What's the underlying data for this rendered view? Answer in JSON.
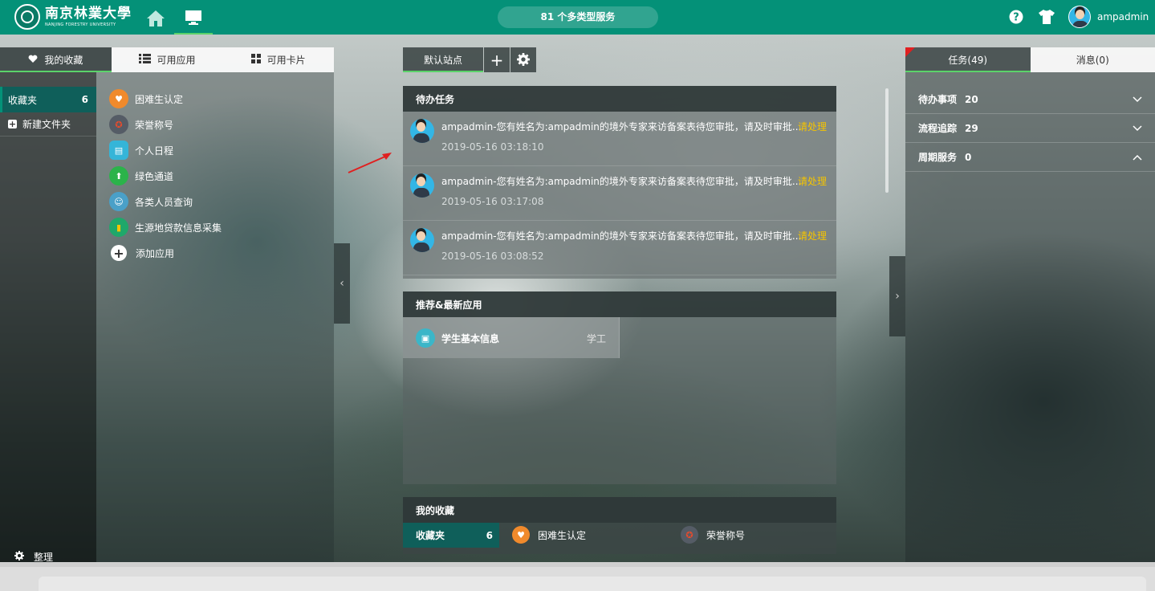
{
  "header": {
    "logo_cn": "南京林業大學",
    "logo_en": "NANJING FORESTRY UNIVERSITY",
    "services_pill": "81 个多类型服务",
    "username": "ampadmin"
  },
  "left": {
    "tabs": [
      {
        "label": "我的收藏",
        "icon": "heart-icon"
      },
      {
        "label": "可用应用",
        "icon": "list-icon"
      },
      {
        "label": "可用卡片",
        "icon": "grid-icon"
      }
    ],
    "folder": {
      "label": "收藏夹",
      "count": "6"
    },
    "new_folder": "新建文件夹",
    "arrange": "整理",
    "apps": [
      {
        "label": "困难生认定",
        "color": "#f08a2c"
      },
      {
        "label": "荣誉称号",
        "color": "#555c66"
      },
      {
        "label": "个人日程",
        "color": "#35b5d8"
      },
      {
        "label": "绿色通道",
        "color": "#2bb34a"
      },
      {
        "label": "各类人员查询",
        "color": "#4aa0c8"
      },
      {
        "label": "生源地贷款信息采集",
        "color": "#1fa86a"
      },
      {
        "label": "添加应用",
        "color": "#ffffff"
      }
    ]
  },
  "center": {
    "station_tab": "默认站点",
    "todo": {
      "title": "待办任务",
      "items": [
        {
          "text": "ampadmin-您有姓名为:ampadmin的境外专家来访备案表待您审批，请及时审批...",
          "action": "请处理",
          "time": "2019-05-16 03:18:10"
        },
        {
          "text": "ampadmin-您有姓名为:ampadmin的境外专家来访备案表待您审批，请及时审批...",
          "action": "请处理",
          "time": "2019-05-16 03:17:08"
        },
        {
          "text": "ampadmin-您有姓名为:ampadmin的境外专家来访备案表待您审批，请及时审批...",
          "action": "请处理",
          "time": "2019-05-16 03:08:52"
        }
      ]
    },
    "recommend": {
      "title": "推荐&最新应用",
      "app": "学生基本信息",
      "tag": "学工"
    },
    "favorites": {
      "title": "我的收藏",
      "folder": "收藏夹",
      "count": "6",
      "app1": "困难生认定",
      "app2": "荣誉称号"
    }
  },
  "right": {
    "tab_tasks": "任务(49)",
    "tab_msgs": "消息(0)",
    "items": [
      {
        "label": "待办事项",
        "count": "20",
        "icon": "chevron-down-icon"
      },
      {
        "label": "流程追踪",
        "count": "29",
        "icon": "chevron-down-icon"
      },
      {
        "label": "周期服务",
        "count": "0",
        "icon": "chevron-up-icon"
      }
    ]
  },
  "colors": {
    "brand": "#049178",
    "accent": "#5bd36a",
    "action": "#f5c400",
    "alert": "#e02020"
  }
}
